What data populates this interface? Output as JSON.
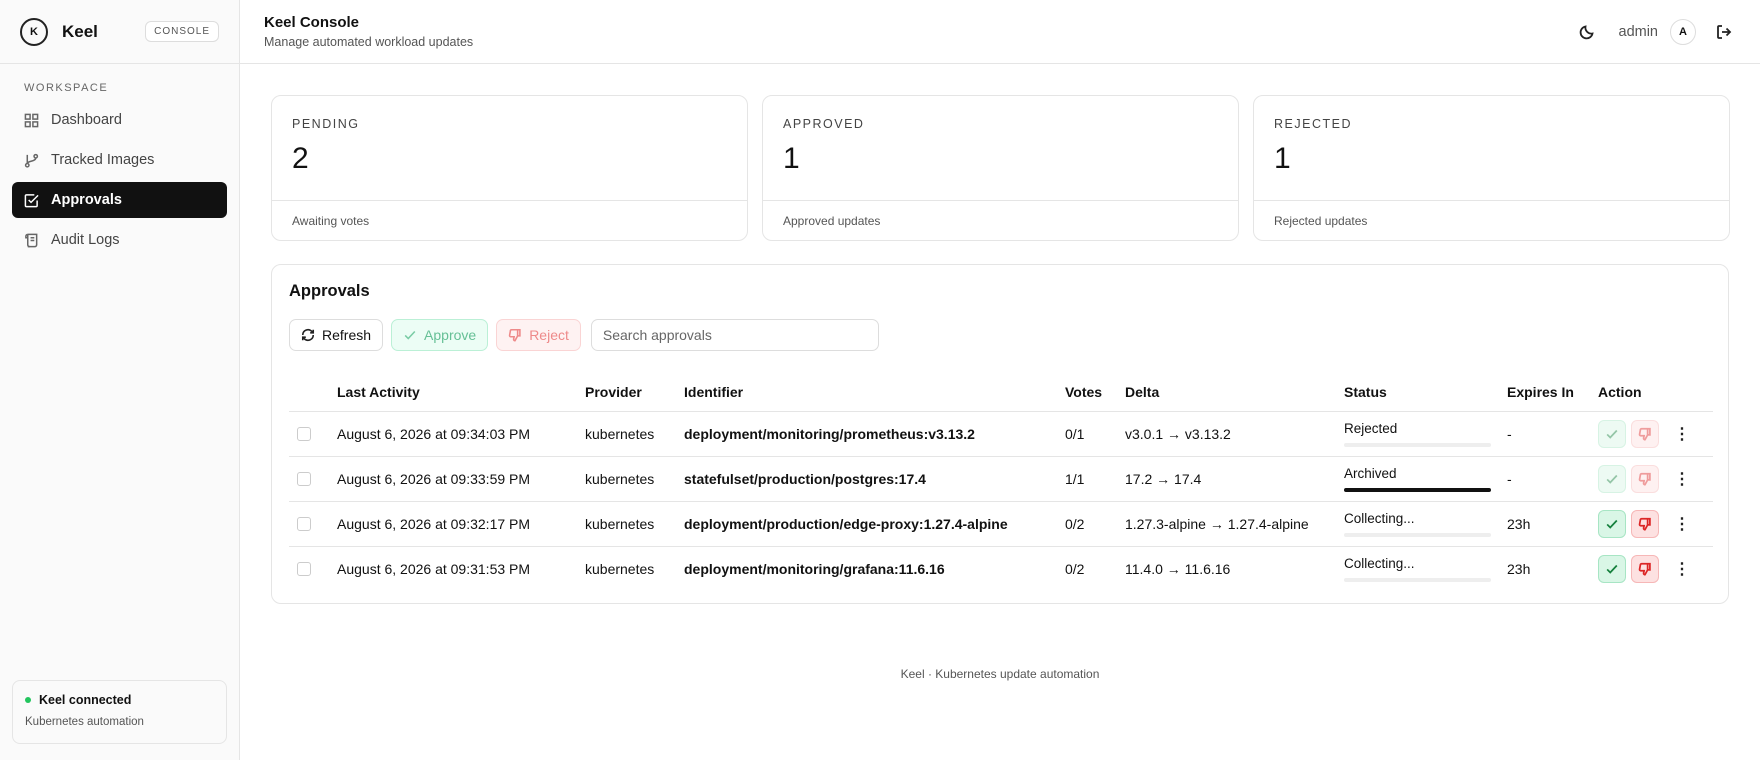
{
  "brand": {
    "name": "Keel",
    "badge": "CONSOLE",
    "logo_text": "K"
  },
  "sidebar": {
    "section": "WORKSPACE",
    "items": [
      {
        "label": "Dashboard",
        "icon": "grid-icon"
      },
      {
        "label": "Tracked Images",
        "icon": "git-branch-icon"
      },
      {
        "label": "Approvals",
        "icon": "check-square-icon",
        "active": true
      },
      {
        "label": "Audit Logs",
        "icon": "scroll-icon"
      }
    ],
    "status": {
      "title": "Keel connected",
      "subtitle": "Kubernetes automation",
      "color": "#22c55e"
    }
  },
  "header": {
    "title": "Keel Console",
    "subtitle": "Manage automated workload updates",
    "user": "admin",
    "avatar": "A"
  },
  "stats": [
    {
      "label": "PENDING",
      "value": "2",
      "footer": "Awaiting votes"
    },
    {
      "label": "APPROVED",
      "value": "1",
      "footer": "Approved updates"
    },
    {
      "label": "REJECTED",
      "value": "1",
      "footer": "Rejected updates"
    }
  ],
  "approvals": {
    "title": "Approvals",
    "toolbar": {
      "refresh": "Refresh",
      "approve": "Approve",
      "reject": "Reject",
      "search_placeholder": "Search approvals"
    },
    "columns": [
      "Last Activity",
      "Provider",
      "Identifier",
      "Votes",
      "Delta",
      "Status",
      "Expires In",
      "Action"
    ],
    "rows": [
      {
        "last_activity": "August 6, 2026 at 09:34:03 PM",
        "provider": "kubernetes",
        "identifier": "deployment/monitoring/prometheus:v3.13.2",
        "votes": "0/1",
        "delta": "v3.0.1 → v3.13.2",
        "status": "Rejected",
        "progress": 0,
        "expires": "-",
        "actions_enabled": false
      },
      {
        "last_activity": "August 6, 2026 at 09:33:59 PM",
        "provider": "kubernetes",
        "identifier": "statefulset/production/postgres:17.4",
        "votes": "1/1",
        "delta": "17.2 → 17.4",
        "status": "Archived",
        "progress": 1,
        "expires": "-",
        "actions_enabled": false
      },
      {
        "last_activity": "August 6, 2026 at 09:32:17 PM",
        "provider": "kubernetes",
        "identifier": "deployment/production/edge-proxy:1.27.4-alpine",
        "votes": "0/2",
        "delta": "1.27.3-alpine → 1.27.4-alpine",
        "status": "Collecting...",
        "progress": 0,
        "expires": "23h",
        "actions_enabled": true
      },
      {
        "last_activity": "August 6, 2026 at 09:31:53 PM",
        "provider": "kubernetes",
        "identifier": "deployment/monitoring/grafana:11.6.16",
        "votes": "0/2",
        "delta": "11.4.0 → 11.6.16",
        "status": "Collecting...",
        "progress": 0,
        "expires": "23h",
        "actions_enabled": true
      }
    ]
  },
  "footer": "Keel · Kubernetes update automation"
}
